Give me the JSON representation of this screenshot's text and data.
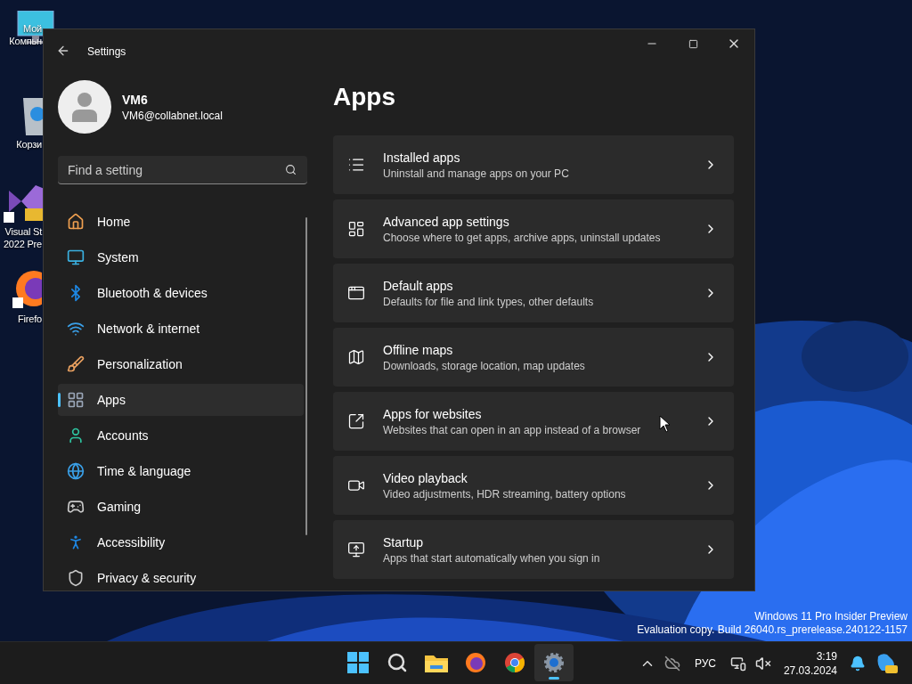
{
  "desktop_icons": [
    {
      "kind": "computer",
      "lines": [
        "Мой",
        "Компьн"
      ]
    },
    {
      "kind": "recycle",
      "lines": [
        "Корзи"
      ]
    },
    {
      "kind": "studio",
      "lines": [
        "Visual St",
        "2022 Pre"
      ]
    },
    {
      "kind": "firefox",
      "lines": [
        "Firefo"
      ]
    }
  ],
  "window": {
    "title": "Settings"
  },
  "user": {
    "name": "VM6",
    "email": "VM6@collabnet.local"
  },
  "search": {
    "placeholder": "Find a setting"
  },
  "nav": [
    {
      "kind": "home",
      "label": "Home",
      "selected": false
    },
    {
      "kind": "system",
      "label": "System",
      "selected": false
    },
    {
      "kind": "bluetooth",
      "label": "Bluetooth & devices",
      "selected": false
    },
    {
      "kind": "network",
      "label": "Network & internet",
      "selected": false
    },
    {
      "kind": "brush",
      "label": "Personalization",
      "selected": false
    },
    {
      "kind": "apps",
      "label": "Apps",
      "selected": true
    },
    {
      "kind": "accounts",
      "label": "Accounts",
      "selected": false
    },
    {
      "kind": "time",
      "label": "Time & language",
      "selected": false
    },
    {
      "kind": "gaming",
      "label": "Gaming",
      "selected": false
    },
    {
      "kind": "accessibility",
      "label": "Accessibility",
      "selected": false
    },
    {
      "kind": "privacy",
      "label": "Privacy & security",
      "selected": false
    }
  ],
  "page_title": "Apps",
  "items": [
    {
      "kind": "list",
      "title": "Installed apps",
      "description": "Uninstall and manage apps on your PC"
    },
    {
      "kind": "advanced",
      "title": "Advanced app settings",
      "description": "Choose where to get apps, archive apps, uninstall updates"
    },
    {
      "kind": "default",
      "title": "Default apps",
      "description": "Defaults for file and link types, other defaults"
    },
    {
      "kind": "maps",
      "title": "Offline maps",
      "description": "Downloads, storage location, map updates"
    },
    {
      "kind": "web",
      "title": "Apps for websites",
      "description": "Websites that can open in an app instead of a browser"
    },
    {
      "kind": "video",
      "title": "Video playback",
      "description": "Video adjustments, HDR streaming, battery options"
    },
    {
      "kind": "startup",
      "title": "Startup",
      "description": "Apps that start automatically when you sign in"
    }
  ],
  "os_notice": [
    "Windows 11 Pro Insider Preview",
    "Evaluation copy. Build 26040.rs_prerelease.240122-1157"
  ],
  "taskbar": {
    "apps": [
      {
        "kind": "start",
        "selected": false
      },
      {
        "kind": "search",
        "selected": false
      },
      {
        "kind": "explorer",
        "selected": false
      },
      {
        "kind": "firefox",
        "selected": false
      },
      {
        "kind": "chrome",
        "selected": false
      },
      {
        "kind": "settings",
        "selected": true
      }
    ],
    "language": "РУС",
    "time": "3:19",
    "date": "27.03.2024"
  }
}
